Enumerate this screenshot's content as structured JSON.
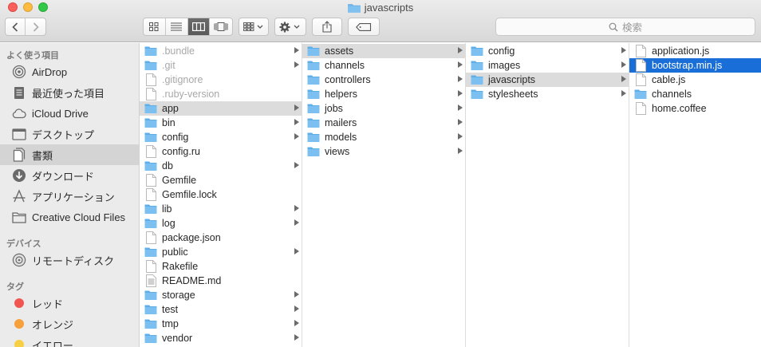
{
  "window": {
    "title": "javascripts"
  },
  "toolbar": {
    "back_icon": "chevron-left-icon",
    "forward_icon": "chevron-right-icon",
    "view_modes": [
      "icon-view-icon",
      "list-view-icon",
      "column-view-icon",
      "cover-flow-icon"
    ],
    "active_view": "column-view-icon",
    "arrange_icon": "arrange-grid-icon",
    "action_icon": "gear-icon",
    "share_icon": "share-icon",
    "tag_icon": "tag-icon",
    "search_placeholder": "検索"
  },
  "sidebar": {
    "favorites_header": "よく使う項目",
    "favorites": [
      {
        "label": "AirDrop",
        "icon": "airdrop-icon"
      },
      {
        "label": "最近使った項目",
        "icon": "recents-icon"
      },
      {
        "label": "iCloud Drive",
        "icon": "cloud-icon"
      },
      {
        "label": "デスクトップ",
        "icon": "desktop-icon"
      },
      {
        "label": "書類",
        "icon": "documents-icon",
        "selected": true
      },
      {
        "label": "ダウンロード",
        "icon": "downloads-icon"
      },
      {
        "label": "アプリケーション",
        "icon": "applications-icon"
      },
      {
        "label": "Creative Cloud Files",
        "icon": "folder-icon"
      }
    ],
    "devices_header": "デバイス",
    "devices": [
      {
        "label": "リモートディスク",
        "icon": "remote-disc-icon"
      }
    ],
    "tags_header": "タグ",
    "tags": [
      {
        "label": "レッド",
        "color": "#f0564f"
      },
      {
        "label": "オレンジ",
        "color": "#f6a13c"
      },
      {
        "label": "イエロー",
        "color": "#f7cf45"
      }
    ]
  },
  "columns": [
    {
      "items": [
        {
          "name": ".bundle",
          "type": "folder",
          "hidden": true
        },
        {
          "name": ".git",
          "type": "folder",
          "hidden": true
        },
        {
          "name": ".gitignore",
          "type": "file",
          "hidden": true
        },
        {
          "name": ".ruby-version",
          "type": "file",
          "hidden": true
        },
        {
          "name": "app",
          "type": "folder",
          "selected": "gray"
        },
        {
          "name": "bin",
          "type": "folder"
        },
        {
          "name": "config",
          "type": "folder"
        },
        {
          "name": "config.ru",
          "type": "file"
        },
        {
          "name": "db",
          "type": "folder"
        },
        {
          "name": "Gemfile",
          "type": "file"
        },
        {
          "name": "Gemfile.lock",
          "type": "file"
        },
        {
          "name": "lib",
          "type": "folder"
        },
        {
          "name": "log",
          "type": "folder"
        },
        {
          "name": "package.json",
          "type": "file"
        },
        {
          "name": "public",
          "type": "folder"
        },
        {
          "name": "Rakefile",
          "type": "file"
        },
        {
          "name": "README.md",
          "type": "text"
        },
        {
          "name": "storage",
          "type": "folder"
        },
        {
          "name": "test",
          "type": "folder"
        },
        {
          "name": "tmp",
          "type": "folder"
        },
        {
          "name": "vendor",
          "type": "folder"
        }
      ]
    },
    {
      "items": [
        {
          "name": "assets",
          "type": "folder",
          "selected": "gray"
        },
        {
          "name": "channels",
          "type": "folder"
        },
        {
          "name": "controllers",
          "type": "folder"
        },
        {
          "name": "helpers",
          "type": "folder"
        },
        {
          "name": "jobs",
          "type": "folder"
        },
        {
          "name": "mailers",
          "type": "folder"
        },
        {
          "name": "models",
          "type": "folder"
        },
        {
          "name": "views",
          "type": "folder"
        }
      ]
    },
    {
      "items": [
        {
          "name": "config",
          "type": "folder"
        },
        {
          "name": "images",
          "type": "folder"
        },
        {
          "name": "javascripts",
          "type": "folder",
          "selected": "gray"
        },
        {
          "name": "stylesheets",
          "type": "folder"
        }
      ]
    },
    {
      "items": [
        {
          "name": "application.js",
          "type": "file"
        },
        {
          "name": "bootstrap.min.js",
          "type": "file",
          "selected": "blue"
        },
        {
          "name": "cable.js",
          "type": "file"
        },
        {
          "name": "channels",
          "type": "folder",
          "noarrow": true
        },
        {
          "name": "home.coffee",
          "type": "file"
        }
      ]
    }
  ]
}
